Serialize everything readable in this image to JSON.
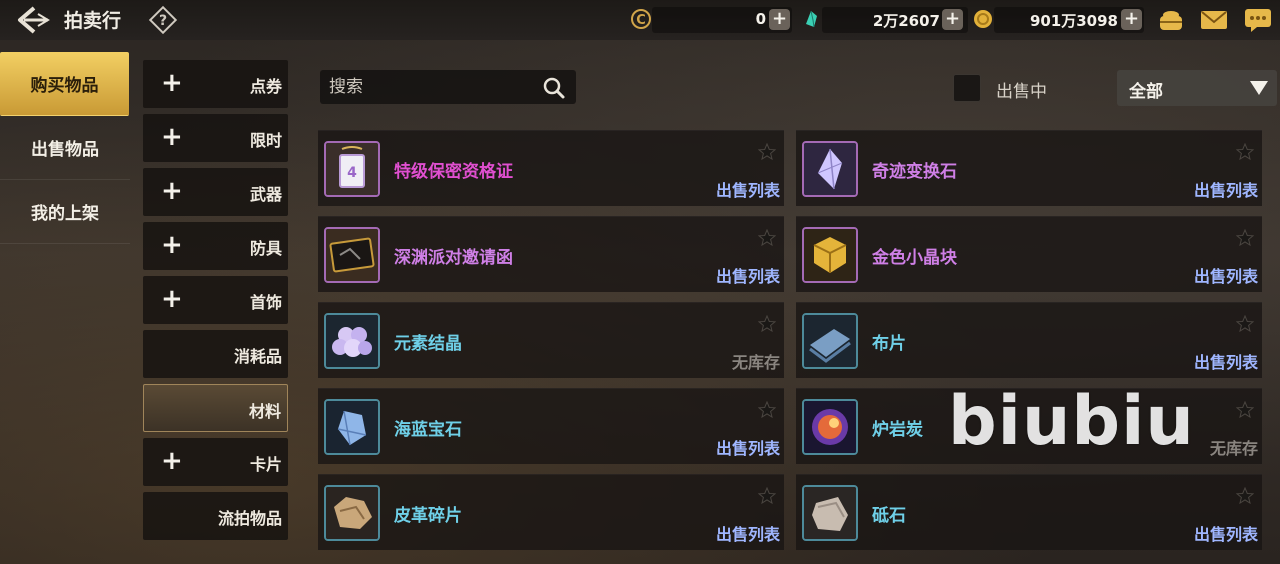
{
  "header": {
    "title": "拍卖行",
    "currencies": [
      {
        "name": "c-coin",
        "value": "0",
        "color": "#d1a54a"
      },
      {
        "name": "gem",
        "value": "2万2607",
        "color": "#3ad0b4"
      },
      {
        "name": "gold-coin",
        "value": "901万3098",
        "color": "#e2b13a"
      }
    ]
  },
  "left_nav": [
    {
      "label": "购买物品",
      "active": true
    },
    {
      "label": "出售物品",
      "active": false
    },
    {
      "label": "我的上架",
      "active": false
    }
  ],
  "categories": [
    {
      "label": "点券",
      "expandable": true
    },
    {
      "label": "限时",
      "expandable": true
    },
    {
      "label": "武器",
      "expandable": true
    },
    {
      "label": "防具",
      "expandable": true
    },
    {
      "label": "首饰",
      "expandable": true
    },
    {
      "label": "消耗品",
      "expandable": false
    },
    {
      "label": "材料",
      "expandable": false,
      "active": true
    },
    {
      "label": "卡片",
      "expandable": true
    },
    {
      "label": "流拍物品",
      "expandable": false
    }
  ],
  "search": {
    "placeholder": "搜索",
    "value": ""
  },
  "filter": {
    "on_sale_label": "出售中",
    "dropdown_value": "全部"
  },
  "items": [
    {
      "name": "特级保密资格证",
      "status": "出售列表",
      "name_color": "#e04fd0",
      "icon": "certificate-icon"
    },
    {
      "name": "奇迹变换石",
      "status": "出售列表",
      "name_color": "#cf7fe6",
      "icon": "crystal-icon"
    },
    {
      "name": "深渊派对邀请函",
      "status": "出售列表",
      "name_color": "#cf7fe6",
      "icon": "invitation-icon"
    },
    {
      "name": "金色小晶块",
      "status": "出售列表",
      "name_color": "#cf7fe6",
      "icon": "gold-cube-icon"
    },
    {
      "name": "元素结晶",
      "status": "无库存",
      "name_color": "#6fd0e8",
      "icon": "element-crystal-icon"
    },
    {
      "name": "布片",
      "status": "出售列表",
      "name_color": "#6fd0e8",
      "icon": "cloth-icon"
    },
    {
      "name": "海蓝宝石",
      "status": "出售列表",
      "name_color": "#6fd0e8",
      "icon": "aquamarine-icon"
    },
    {
      "name": "炉岩炭",
      "status": "无库存",
      "name_color": "#6fd0e8",
      "icon": "lava-coal-icon"
    },
    {
      "name": "皮革碎片",
      "status": "出售列表",
      "name_color": "#6fd0e8",
      "icon": "leather-icon"
    },
    {
      "name": "砥石",
      "status": "出售列表",
      "name_color": "#6fd0e8",
      "icon": "whetstone-icon"
    }
  ],
  "watermark": "biubiu"
}
